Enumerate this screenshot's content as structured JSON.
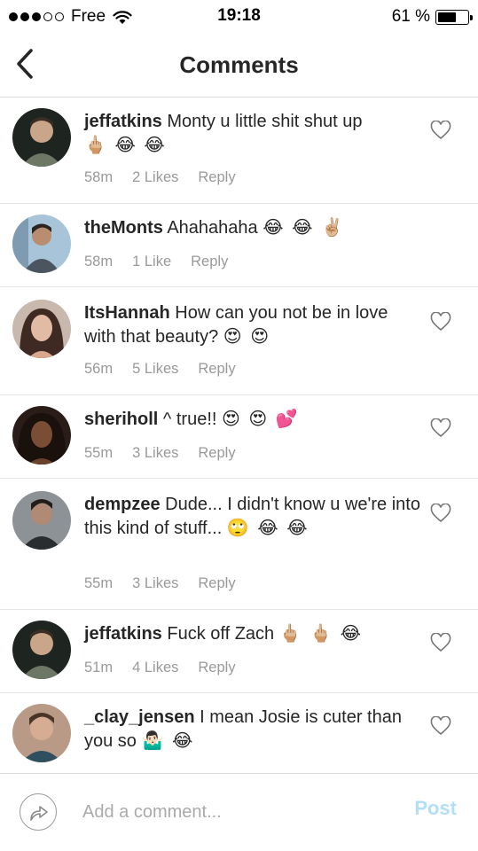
{
  "status_bar": {
    "carrier": "Free",
    "time": "19:18",
    "battery_text": "61 %",
    "battery_level": 0.61
  },
  "nav": {
    "title": "Comments",
    "back_icon": "chevron-left-icon"
  },
  "comments": [
    {
      "username": "jeffatkins",
      "text": "Monty u little shit shut up",
      "emojis": "🖕🏼 😂 😂",
      "time": "58m",
      "likes": "2 Likes",
      "reply": "Reply",
      "has_heart": true,
      "avatar_color": "#3b4a3a"
    },
    {
      "username": "theMonts",
      "text": "Ahahahaha",
      "emojis": "😂 😂 ✌🏼",
      "time": "58m",
      "likes": "1 Like",
      "reply": "Reply",
      "has_heart": false,
      "avatar_color": "#6f8aa1"
    },
    {
      "username": "ItsHannah",
      "text": "How can you not be in love with that beauty?",
      "emojis": "😍 😍",
      "time": "56m",
      "likes": "5 Likes",
      "reply": "Reply",
      "has_heart": true,
      "avatar_color": "#7a5a4e"
    },
    {
      "username": "sheriholl",
      "text": "^ true!!",
      "emojis": "😍 😍 💕",
      "time": "55m",
      "likes": "3 Likes",
      "reply": "Reply",
      "has_heart": true,
      "avatar_color": "#3a2a22"
    },
    {
      "username": "dempzee",
      "text": "Dude... I didn't know u we're into this kind of stuff...",
      "emojis": "🙄 😂 😂",
      "time": "55m",
      "likes": "3 Likes",
      "reply": "Reply",
      "has_heart": true,
      "avatar_color": "#5b5f63"
    },
    {
      "username": "jeffatkins",
      "text": "Fuck off Zach",
      "emojis": "🖕🏼 🖕🏼 😂",
      "time": "51m",
      "likes": "4 Likes",
      "reply": "Reply",
      "has_heart": true,
      "avatar_color": "#3b4a3a"
    },
    {
      "username": "_clay_jensen",
      "text": "I mean Josie is cuter than you so",
      "emojis": "🤷🏻‍♂️ 😂",
      "time": "",
      "likes": "",
      "reply": "",
      "has_heart": true,
      "avatar_color": "#8a6a55"
    }
  ],
  "composer": {
    "placeholder": "Add a comment...",
    "post_label": "Post",
    "post_color": "#b2dffc"
  }
}
